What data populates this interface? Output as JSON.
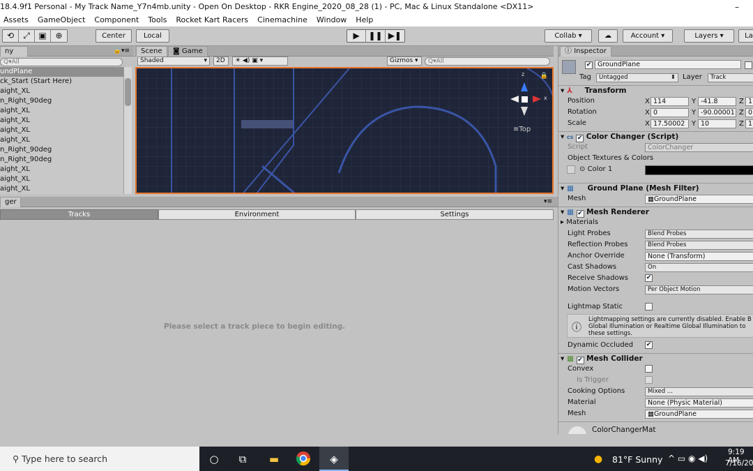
{
  "window": {
    "title": "18.4.9f1 Personal - My Track Name_Y7n4mb.unity - Open On Desktop - RKR Engine_2020_08_28 (1) - PC, Mac & Linux Standalone <DX11>",
    "minimize": "–"
  },
  "menu": [
    "Assets",
    "GameObject",
    "Component",
    "Tools",
    "Rocket Kart Racers",
    "Cinemachine",
    "Window",
    "Help"
  ],
  "toolbar": {
    "tools": [
      "⟲",
      "⤢",
      "▣",
      "⊕"
    ],
    "center": "Center",
    "local": "Local",
    "play": [
      "▶",
      "❚❚",
      "▶❚"
    ],
    "collab": "Collab ▾",
    "cloud": "☁",
    "account": "Account",
    "layers": "Layers",
    "layout": "La"
  },
  "hierarchy": {
    "tab": "ny",
    "search": "Q▾All",
    "items": [
      "undPlane",
      "ck_Start (Start Here)",
      "aight_XL",
      "n_Right_90deg",
      "aight_XL",
      "aight_XL",
      "aight_XL",
      "aight_XL",
      "n_Right_90deg",
      "n_Right_90deg",
      "aight_XL",
      "aight_XL",
      "aight_XL"
    ]
  },
  "scene": {
    "tab_scene": "Scene",
    "tab_game": "Game",
    "shading": "Shaded",
    "mode2d": "2D",
    "gizmos": "Gizmos",
    "search": "Q▾All",
    "gizmo_label": "Top",
    "axis_z": "z",
    "axis_x": "x"
  },
  "manager": {
    "tab": "ger",
    "tabs": [
      "Tracks",
      "Environment",
      "Settings"
    ],
    "empty_message": "Please select a track piece to begin editing."
  },
  "inspector": {
    "tab": "Inspector",
    "object_name": "GroundPlane",
    "tag_label": "Tag",
    "tag_value": "Untagged",
    "layer_label": "Layer",
    "layer_value": "Track",
    "transform": {
      "title": "Transform",
      "position_label": "Position",
      "position": [
        "114",
        "-41.8",
        "1"
      ],
      "rotation_label": "Rotation",
      "rotation": [
        "0",
        "-90.00001",
        "0"
      ],
      "scale_label": "Scale",
      "scale": [
        "17.50002",
        "10",
        "1"
      ]
    },
    "color_changer": {
      "title": "Color Changer (Script)",
      "script_label": "Script",
      "script_value": "ColorChanger",
      "section_label": "Object Textures & Colors",
      "color1_label": "Color 1",
      "color1_value": "#000000"
    },
    "mesh_filter": {
      "title": "Ground Plane (Mesh Filter)",
      "mesh_label": "Mesh",
      "mesh_value": "GroundPlane"
    },
    "mesh_renderer": {
      "title": "Mesh Renderer",
      "materials_label": "Materials",
      "light_probes_label": "Light Probes",
      "light_probes_value": "Blend Probes",
      "reflection_label": "Reflection Probes",
      "reflection_value": "Blend Probes",
      "anchor_label": "Anchor Override",
      "anchor_value": "None (Transform)",
      "cast_label": "Cast Shadows",
      "cast_value": "On",
      "receive_label": "Receive Shadows",
      "motion_label": "Motion Vectors",
      "motion_value": "Per Object Motion",
      "lightmap_label": "Lightmap Static",
      "info_text": "Lightmapping settings are currently disabled. Enable B Global Illumination or Realtime Global Illumination to these settings.",
      "dynamic_label": "Dynamic Occluded"
    },
    "mesh_collider": {
      "title": "Mesh Collider",
      "convex_label": "Convex",
      "trigger_label": "Is Trigger",
      "cooking_label": "Cooking Options",
      "cooking_value": "Mixed ...",
      "material_label": "Material",
      "material_value": "None (Physic Material)",
      "mesh_label": "Mesh",
      "mesh_value": "GroundPlane"
    },
    "material_peek": "ColorChangerMat"
  },
  "taskbar": {
    "search": "Type here to search",
    "weather": "81°F  Sunny",
    "time": "9:19 AM",
    "date": "7/16/202"
  },
  "colors": {
    "selection_border": "#e8752a",
    "scene_bg": "#1f2538",
    "track_line": "#3a55a6"
  }
}
